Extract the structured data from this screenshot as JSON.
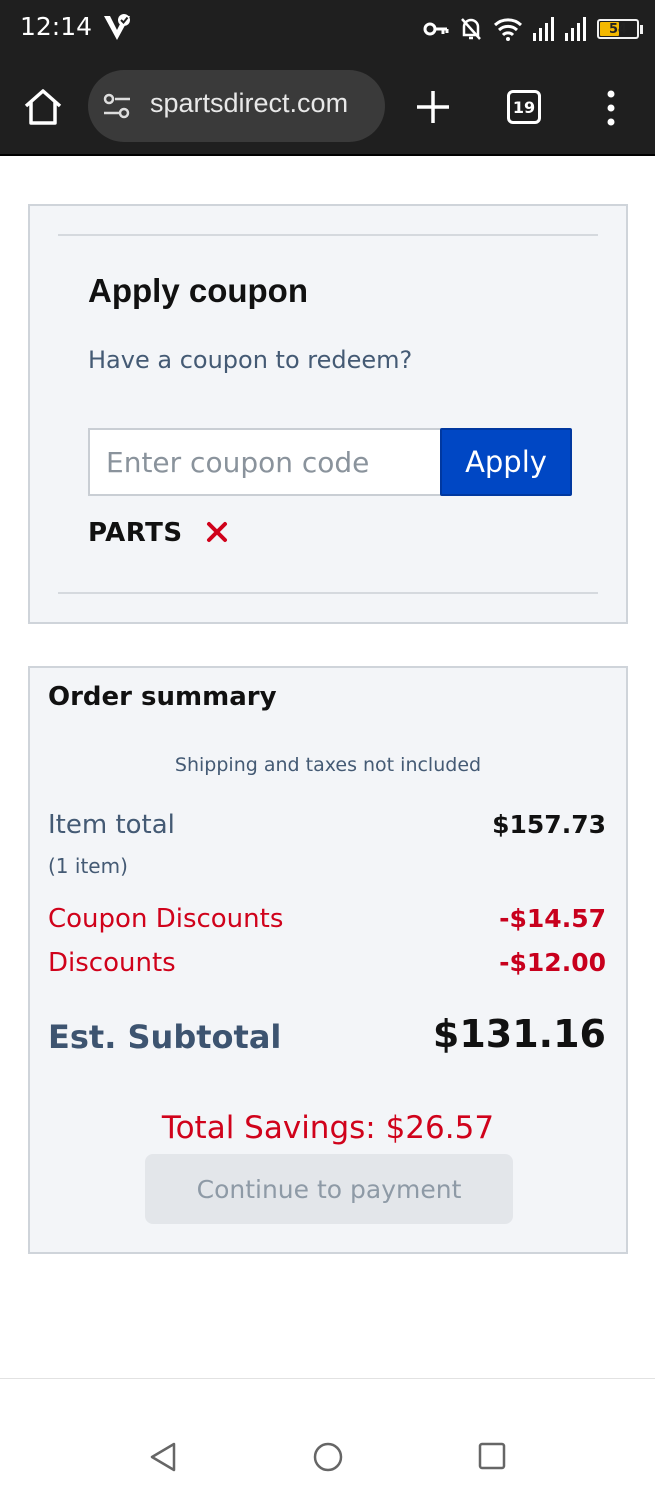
{
  "status_bar": {
    "time": "12:14",
    "battery_level": "54",
    "icons": [
      "vpn-key-icon",
      "notifications-off-icon",
      "wifi-icon",
      "signal-icon",
      "signal-icon",
      "battery-icon"
    ]
  },
  "browser": {
    "url": "spartsdirect.com",
    "tab_count": "19"
  },
  "coupon": {
    "title": "Apply coupon",
    "subtitle": "Have a coupon to redeem?",
    "input_placeholder": "Enter coupon code",
    "input_value": "",
    "apply_label": "Apply",
    "applied_code": "PARTS"
  },
  "summary": {
    "title": "Order summary",
    "shipping_note": "Shipping and taxes not included",
    "item_total_label": "Item total",
    "item_count": "(1 item)",
    "item_total_value": "$157.73",
    "coupon_discounts_label": "Coupon Discounts",
    "coupon_discounts_value": "-$14.57",
    "discounts_label": "Discounts",
    "discounts_value": "-$12.00",
    "subtotal_label": "Est. Subtotal",
    "subtotal_value": "$131.16",
    "total_savings": "Total Savings: $26.57",
    "continue_label": "Continue to payment"
  },
  "colors": {
    "accent_blue": "#0047c4",
    "discount_red": "#d0021b",
    "battery_fill": "#f3b800"
  }
}
